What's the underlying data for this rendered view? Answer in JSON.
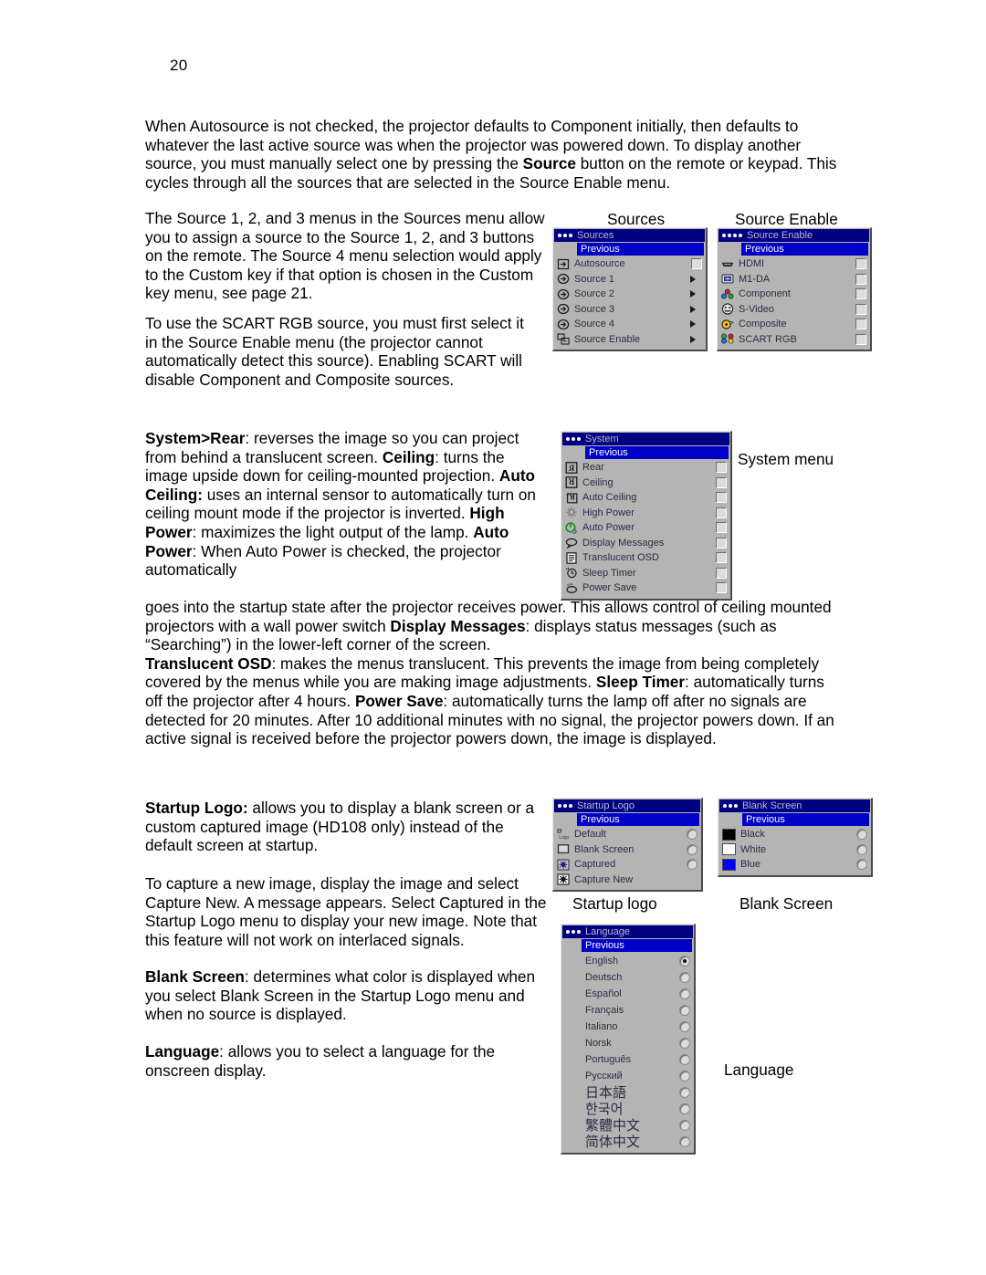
{
  "page": {
    "number": "20"
  },
  "paragraphs": {
    "intro": "When Autosource is not checked, the projector defaults to Component initially, then defaults to whatever the last active source was when the projector was powered down. To display another source, you must manually select one by pressing the <b>Source</b> button on the remote or keypad. This cycles through all the sources that are selected in the Source Enable menu.",
    "source_menus": "The Source 1, 2, and 3 menus in the Sources menu allow you to assign a source to the Source 1, 2, and 3 buttons on the remote. The Source 4 menu selection would apply to the Custom key if that option is chosen in the Custom key menu, see page 21.",
    "scart": "To use the SCART RGB source, you must first select it in the Source Enable menu (the projector cannot automatically detect this source). Enabling SCART will disable Component and Composite sources.",
    "system": "<b>System&gt;Rear</b>: reverses the image so you can project from behind a translucent screen. <b>Ceiling</b>: turns the image upside down for ceiling-mounted projection. <b>Auto Ceiling:</b> uses an internal sensor to automatically turn on ceiling mount mode if the projector is inverted. <b>High Power</b>: maximizes the light output of the lamp. <b>Auto Power</b>: When Auto Power is checked, the projector automatically",
    "system_cont": "goes into the startup state after the projector receives power. This allows control of ceiling mounted projectors with a wall power switch <b>Display Messages</b>: displays status messages (such as &ldquo;Searching&rdquo;) in the lower-left corner of the screen.<br><b>Translucent OSD</b>: makes the menus translucent. This prevents the image from being completely covered by the menus while you are making image adjustments. <b>Sleep Timer</b>: automatically turns off the projector after 4 hours. <b>Power Save</b>: automatically turns the lamp off after no signals are detected for 20 minutes. After 10 additional minutes with no signal, the projector powers down. If an active signal is received before the projector powers down, the image is displayed.",
    "startup_logo": "<b>Startup Logo:</b> allows you to display a blank screen or a custom captured image (HD108 only) instead of the default screen at startup.",
    "capture": "To capture a new image, display the image and select Capture New. A message appears. Select Captured in the Startup Logo menu to display your new image. Note that this feature will not work on interlaced signals.",
    "blank_screen": "<b>Blank Screen</b>: determines what color is displayed when you select Blank Screen in the Startup Logo menu and when no source is displayed.",
    "language": "<b>Language</b>: allows you to select a language for the onscreen display."
  },
  "captions": {
    "sources": "Sources",
    "source_enable": "Source Enable",
    "system": "System menu",
    "startup_logo": "Startup logo",
    "blank_screen": "Blank Screen",
    "language": "Language"
  },
  "colors": {
    "titlebar": "#000080",
    "highlight": "#0000c8",
    "menu_background": "#b4b4b4",
    "menu_text": "#2b2b45",
    "blank_black": "#000000",
    "blank_white": "#ffffff",
    "blank_blue": "#0000ff"
  },
  "menus": {
    "sources": {
      "title": "Sources",
      "dots": 3,
      "previous": "Previous",
      "items": [
        {
          "label": "Autosource",
          "icon": "autosource-icon",
          "control": "checkbox"
        },
        {
          "label": "Source 1",
          "icon": "source-icon",
          "control": "submenu"
        },
        {
          "label": "Source 2",
          "icon": "source-icon",
          "control": "submenu"
        },
        {
          "label": "Source 3",
          "icon": "source-icon",
          "control": "submenu"
        },
        {
          "label": "Source 4",
          "icon": "source-icon",
          "control": "submenu"
        },
        {
          "label": "Source Enable",
          "icon": "source-enable-icon",
          "control": "submenu"
        }
      ]
    },
    "source_enable": {
      "title": "Source Enable",
      "dots": 4,
      "previous": "Previous",
      "items": [
        {
          "label": "HDMI",
          "icon": "hdmi-icon",
          "control": "checkbox"
        },
        {
          "label": "M1-DA",
          "icon": "m1da-icon",
          "control": "checkbox"
        },
        {
          "label": "Component",
          "icon": "component-icon",
          "control": "checkbox"
        },
        {
          "label": "S-Video",
          "icon": "svideo-icon",
          "control": "checkbox"
        },
        {
          "label": "Composite",
          "icon": "composite-icon",
          "control": "checkbox"
        },
        {
          "label": "SCART RGB",
          "icon": "scart-icon",
          "control": "checkbox"
        }
      ]
    },
    "system": {
      "title": "System",
      "dots": 3,
      "previous": "Previous",
      "items": [
        {
          "label": "Rear",
          "icon": "rear-icon",
          "control": "checkbox"
        },
        {
          "label": "Ceiling",
          "icon": "ceiling-icon",
          "control": "checkbox"
        },
        {
          "label": "Auto Ceiling",
          "icon": "auto-ceiling-icon",
          "control": "checkbox"
        },
        {
          "label": "High Power",
          "icon": "lamp-icon",
          "control": "checkbox"
        },
        {
          "label": "Auto Power",
          "icon": "power-icon",
          "control": "checkbox"
        },
        {
          "label": "Display Messages",
          "icon": "message-icon",
          "control": "checkbox"
        },
        {
          "label": "Translucent OSD",
          "icon": "osd-icon",
          "control": "checkbox"
        },
        {
          "label": "Sleep Timer",
          "icon": "clock-icon",
          "control": "checkbox"
        },
        {
          "label": "Power Save",
          "icon": "power-save-icon",
          "control": "checkbox"
        }
      ]
    },
    "startup_logo": {
      "title": "Startup Logo",
      "dots": 3,
      "previous": "Previous",
      "items": [
        {
          "label": "Default",
          "icon": "logo-icon",
          "control": "radio",
          "selected": false
        },
        {
          "label": "Blank Screen",
          "icon": "blank-icon",
          "control": "radio",
          "selected": false
        },
        {
          "label": "Captured",
          "icon": "captured-icon",
          "control": "radio",
          "selected": false
        },
        {
          "label": "Capture New",
          "icon": "capture-new-icon",
          "control": "none"
        }
      ]
    },
    "blank_screen": {
      "title": "Blank Screen",
      "dots": 3,
      "previous": "Previous",
      "items": [
        {
          "label": "Black",
          "icon": "black-swatch",
          "control": "radio",
          "selected": false
        },
        {
          "label": "White",
          "icon": "white-swatch",
          "control": "radio",
          "selected": false
        },
        {
          "label": "Blue",
          "icon": "blue-swatch",
          "control": "radio",
          "selected": false
        }
      ]
    },
    "language": {
      "title": "Language",
      "dots": 3,
      "previous": "Previous",
      "items": [
        {
          "label": "English",
          "control": "radio",
          "selected": true
        },
        {
          "label": "Deutsch",
          "control": "radio",
          "selected": false
        },
        {
          "label": "Español",
          "control": "radio",
          "selected": false
        },
        {
          "label": "Français",
          "control": "radio",
          "selected": false
        },
        {
          "label": "Italiano",
          "control": "radio",
          "selected": false
        },
        {
          "label": "Norsk",
          "control": "radio",
          "selected": false
        },
        {
          "label": "Português",
          "control": "radio",
          "selected": false
        },
        {
          "label": "Русский",
          "control": "radio",
          "selected": false
        },
        {
          "label": "日本語",
          "control": "radio",
          "selected": false,
          "cjk": true
        },
        {
          "label": "한국어",
          "control": "radio",
          "selected": false,
          "cjk": true
        },
        {
          "label": "繁體中文",
          "control": "radio",
          "selected": false,
          "cjk": true
        },
        {
          "label": "简体中文",
          "control": "radio",
          "selected": false,
          "cjk": true
        }
      ]
    }
  }
}
